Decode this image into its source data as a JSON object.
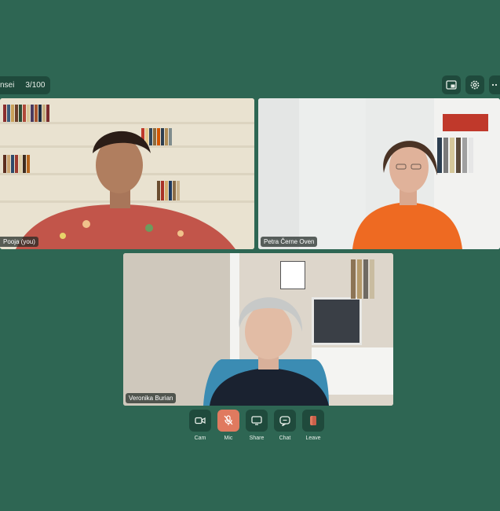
{
  "header": {
    "room_name": "nsei",
    "participant_count": "3/100"
  },
  "toolbar_right": {
    "icons": [
      "picture-in-picture-icon",
      "gear-icon",
      "more-icon"
    ]
  },
  "participants": [
    {
      "name": "Pooja (you)"
    },
    {
      "name": "Petra Černe Oven"
    },
    {
      "name": "Veronika Burian"
    }
  ],
  "controls": [
    {
      "label": "Cam",
      "icon": "camera-icon"
    },
    {
      "label": "Mic",
      "icon": "mic-muted-icon",
      "state": "muted"
    },
    {
      "label": "Share",
      "icon": "screen-share-icon"
    },
    {
      "label": "Chat",
      "icon": "chat-icon"
    },
    {
      "label": "Leave",
      "icon": "leave-icon"
    }
  ],
  "colors": {
    "background": "#2e6653",
    "button": "#1f4a3c",
    "muted_accent": "#e07a5f"
  }
}
